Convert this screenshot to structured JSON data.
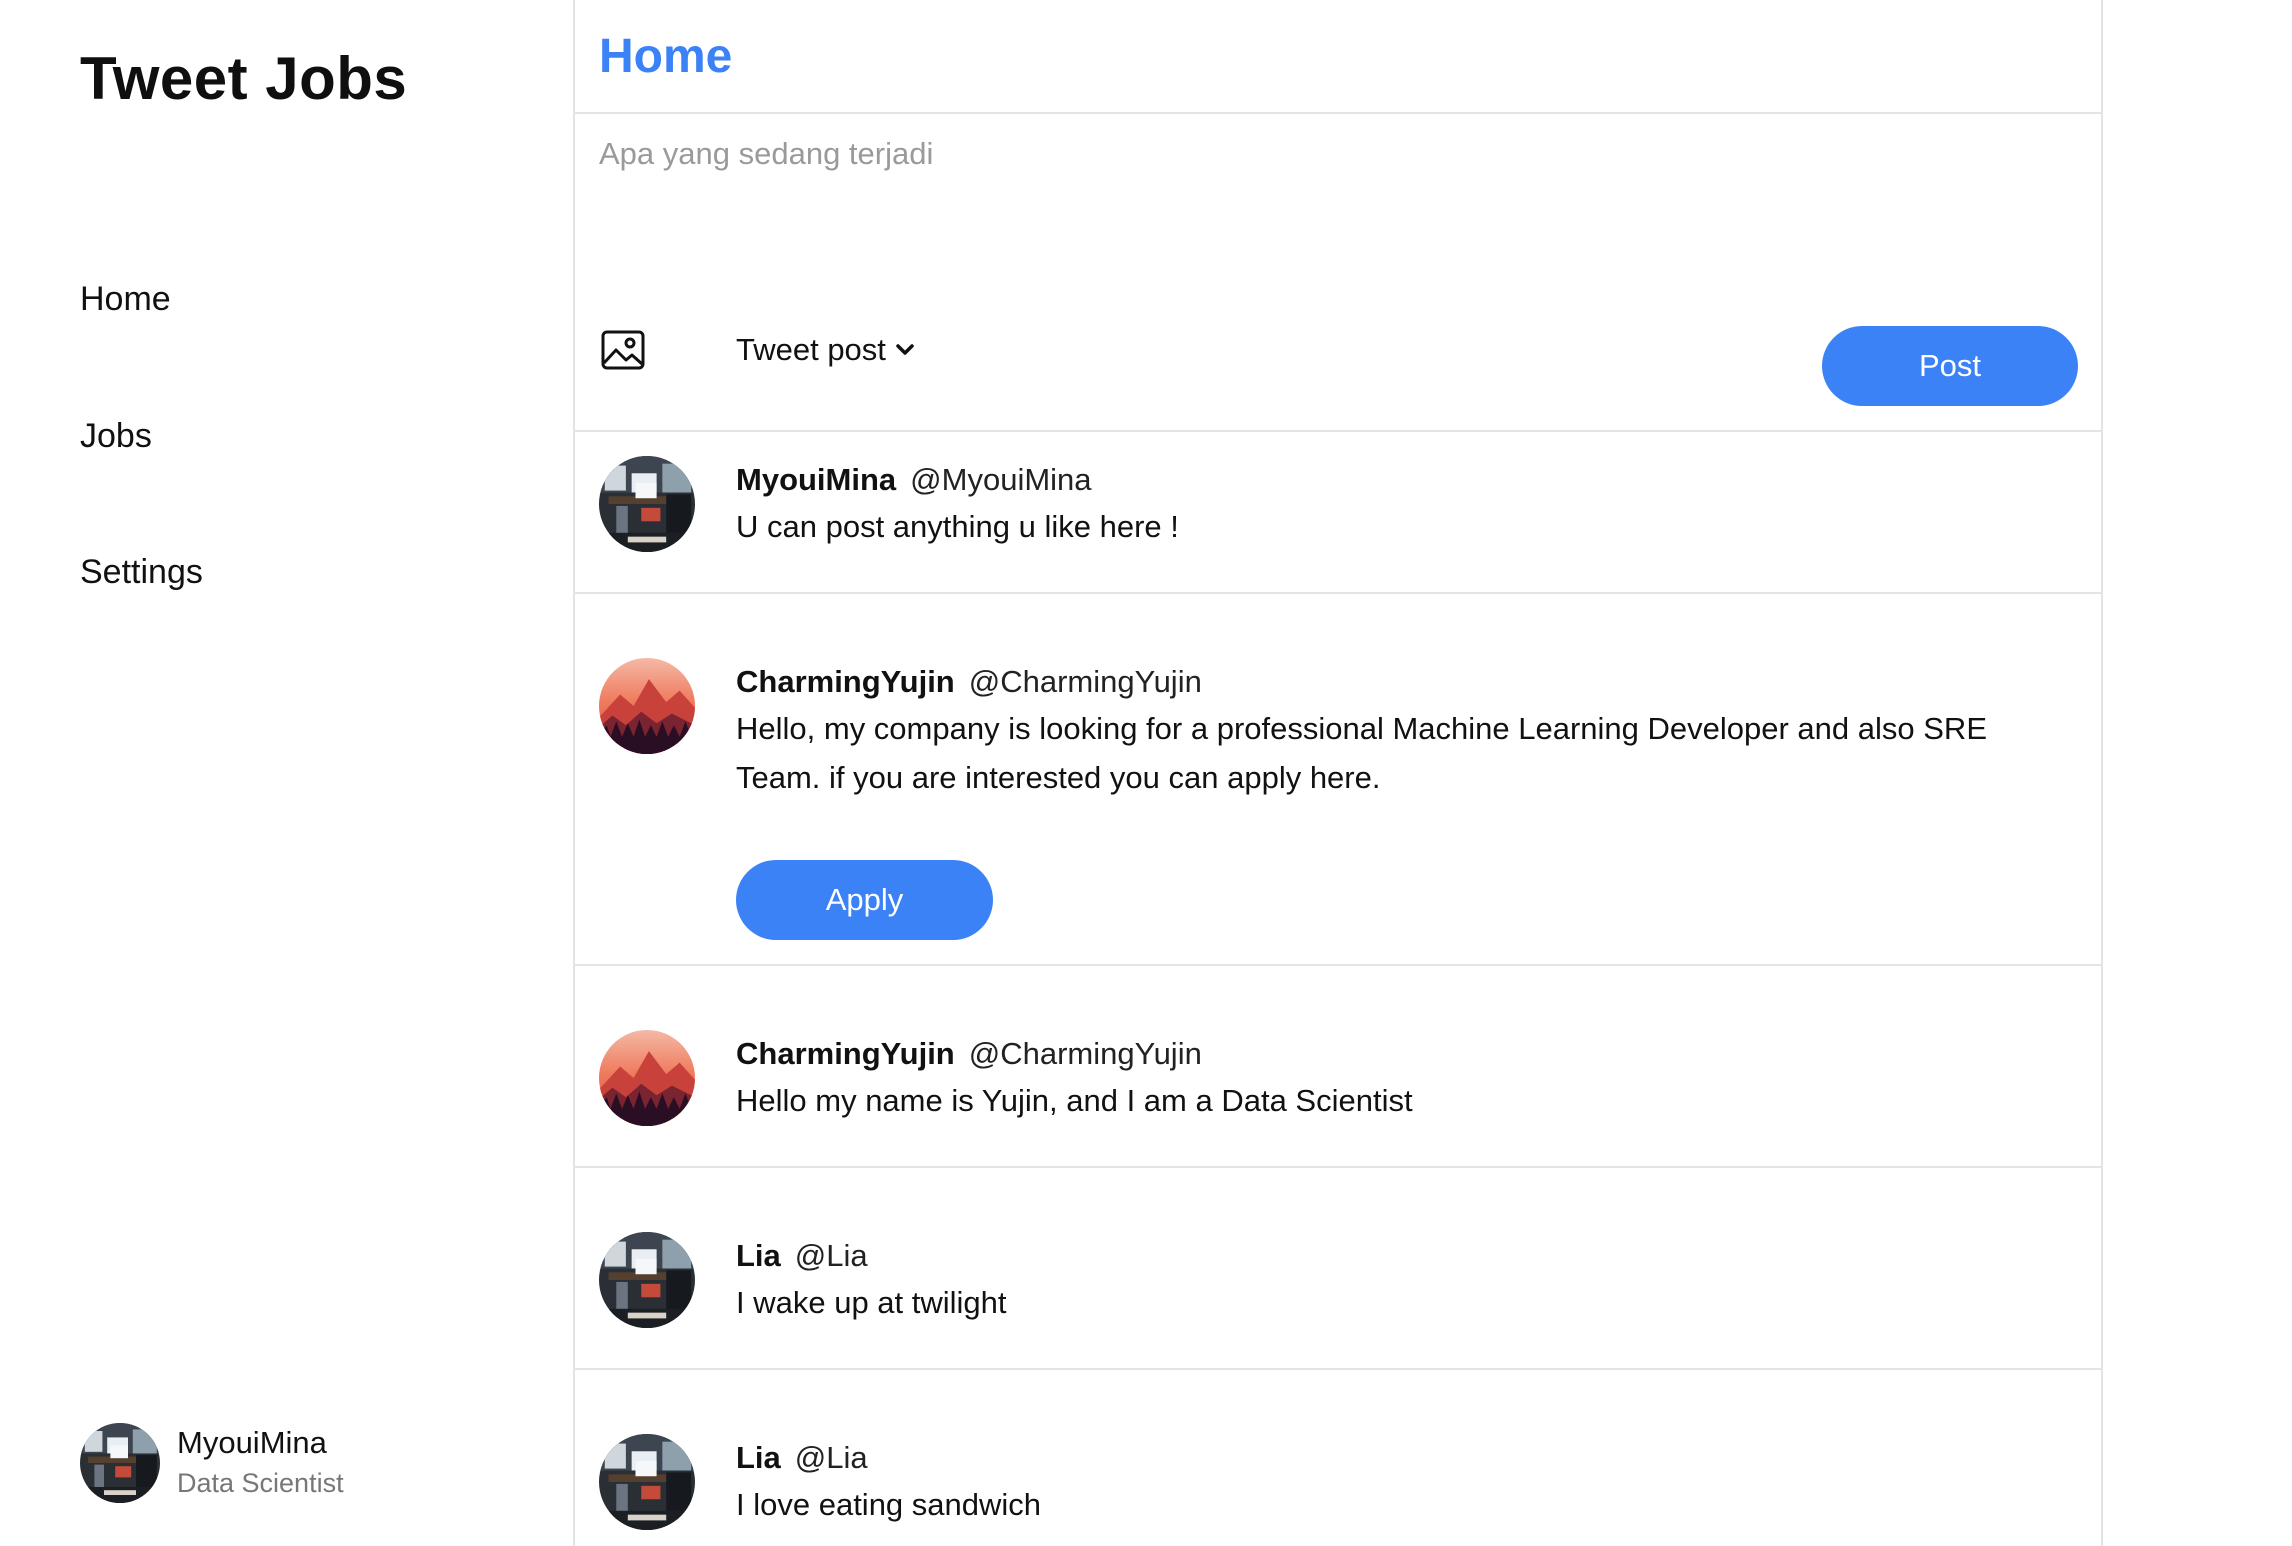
{
  "sidebar": {
    "brand": "Tweet Jobs",
    "nav": [
      {
        "label": "Home"
      },
      {
        "label": "Jobs"
      },
      {
        "label": "Settings"
      }
    ],
    "profile": {
      "name": "MyouiMina",
      "role": "Data Scientist",
      "avatar": "room-photo"
    }
  },
  "header": {
    "title": "Home"
  },
  "composer": {
    "placeholder": "Apa yang sedang terjadi",
    "image_icon": "image-icon",
    "post_type_label": "Tweet post",
    "post_button_label": "Post"
  },
  "tweets": [
    {
      "name": "MyouiMina",
      "handle": "@MyouiMina",
      "text": "U can post anything u like here !",
      "avatar": "room-photo"
    },
    {
      "name": "CharmingYujin",
      "handle": "@CharmingYujin",
      "text": "Hello, my company is looking for a professional Machine Learning Developer and also SRE Team. if you are interested you can apply here.",
      "avatar": "sunset-mountain",
      "action_label": "Apply"
    },
    {
      "name": "CharmingYujin",
      "handle": "@CharmingYujin",
      "text": "Hello my name is Yujin, and I am a Data Scientist",
      "avatar": "sunset-mountain"
    },
    {
      "name": "Lia",
      "handle": "@Lia",
      "text": "I wake up at twilight",
      "avatar": "room-photo"
    },
    {
      "name": "Lia",
      "handle": "@Lia",
      "text": "I love eating sandwich",
      "avatar": "room-photo"
    }
  ],
  "colors": {
    "accent": "#3b82f6",
    "divider": "#e4e4e4",
    "muted": "#9a9a9a"
  }
}
